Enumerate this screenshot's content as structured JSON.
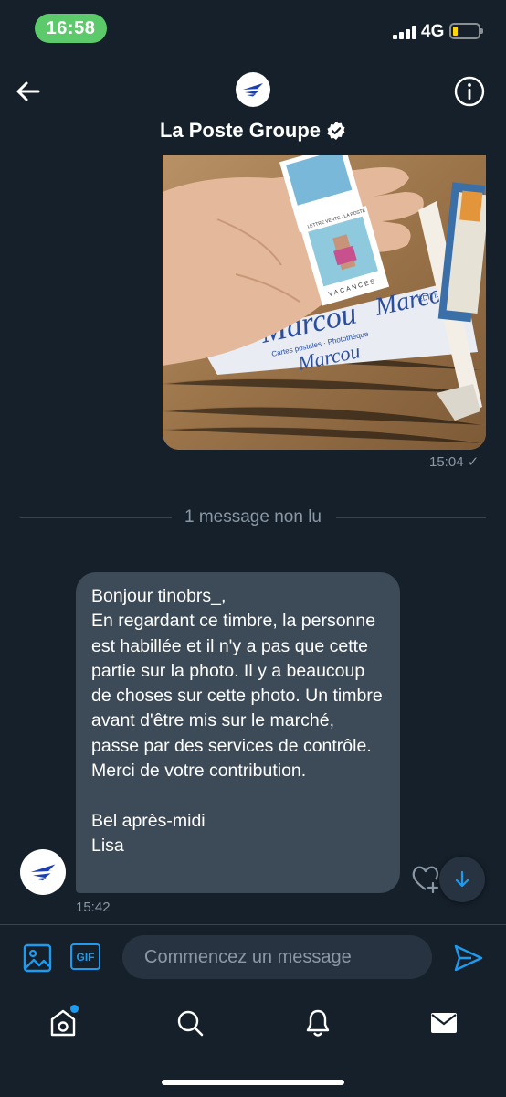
{
  "status_bar": {
    "time": "16:58",
    "network": "4G"
  },
  "header": {
    "title": "La Poste Groupe",
    "verified": true
  },
  "photo_message": {
    "time": "15:04",
    "status": "✓",
    "stamp_lines": [
      "LETTRE VERTE · LA POSTE",
      "VACANCES"
    ],
    "paper_text": [
      "ÉDITIONS",
      "Marcou",
      "Cartes postales · Photothèque"
    ]
  },
  "unread_divider": {
    "label": "1 message non lu"
  },
  "incoming_message": {
    "text": "Bonjour tinobrs_,\nEn regardant ce timbre, la personne est habillée et il n'y a pas que cette partie sur la photo. Il y a beaucoup de choses sur cette photo. Un timbre avant d'être mis sur le marché, passe par des services de contrôle.\nMerci de votre contribution.\n\nBel après-midi\nLisa",
    "time": "15:42"
  },
  "composer": {
    "placeholder": "Commencez un message",
    "gif_label": "GIF"
  },
  "colors": {
    "accent": "#1d9bf0",
    "background": "#15202b",
    "bubble": "#3d4a57",
    "status_pill": "#5cc96a",
    "logo_blue": "#1d3fae"
  },
  "icons": {
    "back": "arrow-left-icon",
    "info": "info-icon",
    "verified": "verified-badge-icon",
    "media": "image-icon",
    "gif": "gif-icon",
    "send": "send-icon",
    "react": "heart-plus-icon",
    "scroll_down": "arrow-down-icon",
    "tabs": [
      "home-icon",
      "search-icon",
      "bell-icon",
      "mail-icon"
    ]
  }
}
